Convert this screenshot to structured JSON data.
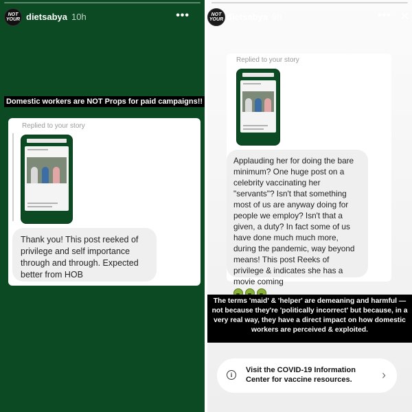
{
  "left": {
    "username": "dietsabya",
    "time": "10h",
    "avatar_text": "NOT YOUR",
    "menu_icon": "more-dots-icon",
    "headline": "Domestic workers are NOT Props for paid campaigns!!",
    "replied_label": "Replied to your story",
    "message": "Thank you! This post reeked of privilege and self importance through and through. Expected better from HOB",
    "colors": {
      "background": "#0b4a22"
    }
  },
  "right": {
    "username": "dietsabya",
    "time": "9h",
    "avatar_text": "NOT YOUR",
    "menu_icon": "more-dots-icon",
    "close_icon": "close-icon",
    "replied_label": "Replied to your story",
    "message": "Applauding her for doing the bare minimum? One huge post on a celebrity vaccinating her \"servants\"? Isn't that something most  of us are anyway doing for people we employ? Isn't that a given, a duty? In fact some of us have  done  much much more, during the pandemic, way beyond means! This post Reeks of privilege & indicates she has a movie coming",
    "emoji_icons": [
      "nauseated-face-icon",
      "nauseated-face-icon",
      "nauseated-face-icon"
    ],
    "statement": "The terms 'maid' & 'helper' are demeaning and harmful — not because they're 'politically incorrect' but because, in a very real way, they have a direct impact on how domestic workers are perceived & exploited.",
    "covid_banner": {
      "text": "Visit the COVID-19 Information Center for vaccine resources.",
      "icon": "info-icon",
      "chevron": "chevron-right-icon"
    }
  }
}
